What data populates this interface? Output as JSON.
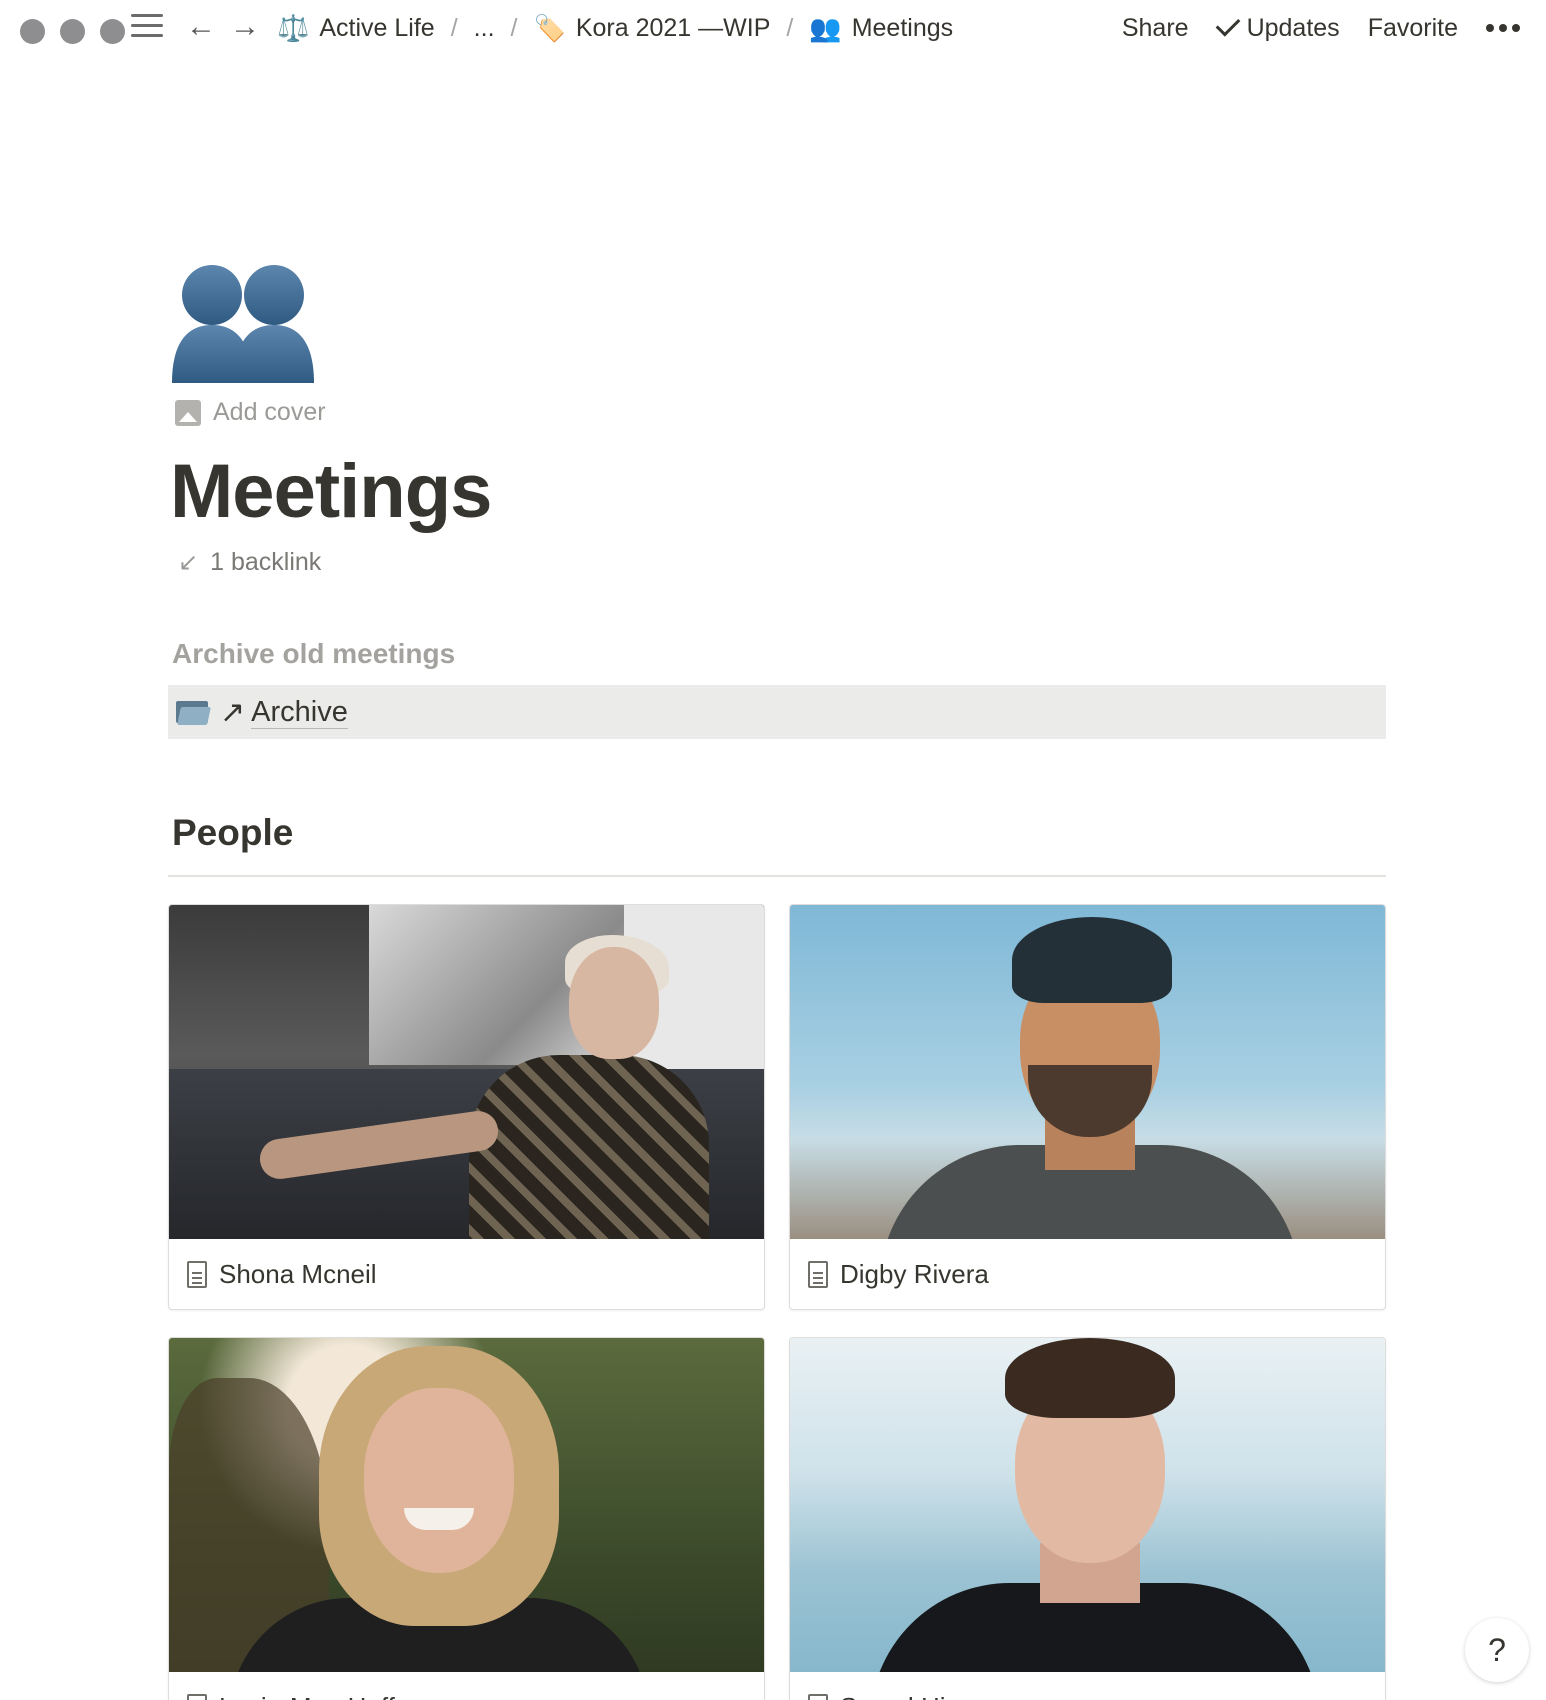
{
  "window": {
    "controls": [
      "close",
      "minimize",
      "zoom"
    ]
  },
  "breadcrumb": {
    "items": [
      {
        "icon": "⚖️",
        "label": "Active Life"
      },
      {
        "icon": "",
        "label": "..."
      },
      {
        "icon": "🏷️",
        "label": "Kora 2021 —WIP"
      },
      {
        "icon": "👥",
        "label": "Meetings"
      }
    ],
    "separator": "/"
  },
  "actions": {
    "share": "Share",
    "updates": "Updates",
    "favorite": "Favorite"
  },
  "page": {
    "icon": "busts-in-silhouette-icon",
    "add_cover": "Add cover",
    "title": "Meetings",
    "backlink": "1 backlink"
  },
  "archive": {
    "heading": "Archive old meetings",
    "link": "Archive"
  },
  "people": {
    "heading": "People",
    "cards": [
      {
        "name": "Shona Mcneil"
      },
      {
        "name": "Digby Rivera"
      },
      {
        "name": "Lacie-Mae Huff"
      },
      {
        "name": "Sayed Hines"
      }
    ]
  },
  "help": {
    "label": "?"
  }
}
